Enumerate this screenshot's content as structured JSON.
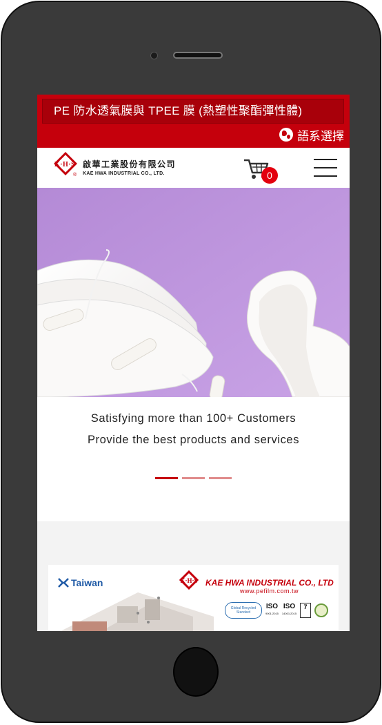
{
  "header": {
    "page_title": "PE 防水透氣膜與 TPEE 膜 (熱塑性聚酯彈性體)",
    "language_label": "語系選擇"
  },
  "nav": {
    "logo_cn": "啟華工業股份有限公司",
    "logo_en": "KAE HWA INDUSTRIAL CO., LTD.",
    "logo_mark": "K·H·S",
    "cart_count": "0"
  },
  "hero": {
    "caption_line1": "Satisfying more than 100+ Customers",
    "caption_line2": "Provide the best products and services",
    "slides_total": 3,
    "active_slide": 1
  },
  "banner": {
    "region": "Taiwan",
    "mark": "K·H·S",
    "company": "KAE HWA INDUSTRIAL CO., LTD",
    "url": "www.pefilm.com.tw",
    "cert_grs": "Global Recycled Standard",
    "cert_iso1": "ISO",
    "cert_iso1_sub": "9001:2015",
    "cert_iso2": "ISO",
    "cert_iso2_sub": "14001:2015",
    "cert_sq": "7"
  },
  "colors": {
    "brand_red": "#c5000c",
    "hero_background": "#b98fd9"
  }
}
